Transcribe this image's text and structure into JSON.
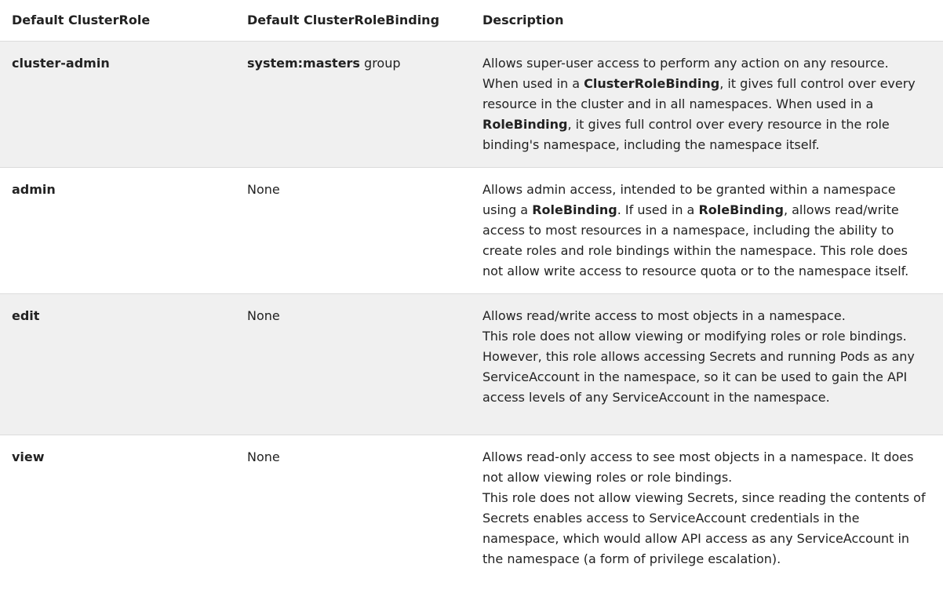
{
  "table": {
    "headers": [
      "Default ClusterRole",
      "Default ClusterRoleBinding",
      "Description"
    ],
    "rows": [
      {
        "role": "cluster-admin",
        "binding_bold": "system:masters",
        "binding_rest": " group",
        "desc": [
          "Allows super-user access to perform any action on any resource.",
          "When used in a ",
          "ClusterRoleBinding",
          ", it gives full control over every resource in the cluster and in all namespaces. When used in a ",
          "RoleBinding",
          ", it gives full control over every resource in the role binding's namespace, including the namespace itself."
        ]
      },
      {
        "role": "admin",
        "binding": "None",
        "desc": [
          "Allows admin access, intended to be granted within a namespace using a ",
          "RoleBinding",
          ". If used in a ",
          "RoleBinding",
          ", allows read/write access to most resources in a namespace, including the ability to create roles and role bindings within the namespace. This role does not allow write access to resource quota or to the namespace itself."
        ]
      },
      {
        "role": "edit",
        "binding": "None",
        "desc": [
          "Allows read/write access to most objects in a namespace.",
          "This role does not allow viewing or modifying roles or role bindings. However, this role allows accessing Secrets and running Pods as any ServiceAccount in the namespace, so it can be used to gain the API access levels of any ServiceAccount in the namespace."
        ]
      },
      {
        "role": "view",
        "binding": "None",
        "desc": [
          "Allows read-only access to see most objects in a namespace. It does not allow viewing roles or role bindings.",
          "This role does not allow viewing Secrets, since reading the contents of Secrets enables access to ServiceAccount credentials in the namespace, which would allow API access as any ServiceAccount in the namespace (a form of privilege escalation)."
        ]
      }
    ]
  }
}
